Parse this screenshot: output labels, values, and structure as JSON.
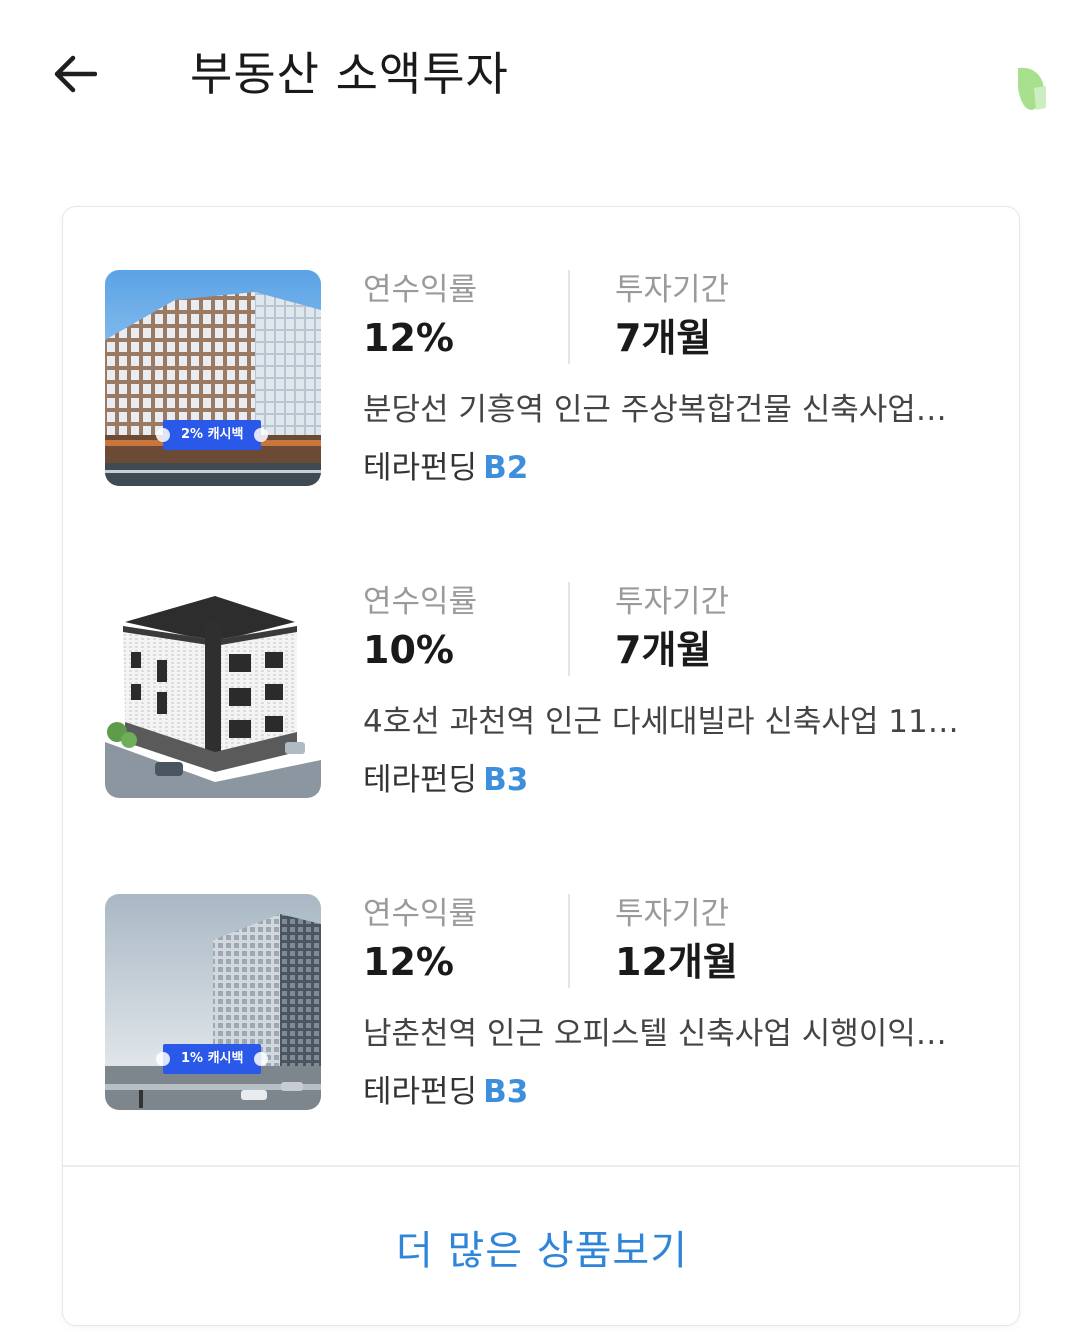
{
  "header": {
    "title": "부동산 소액투자",
    "back_icon": "arrow-left-icon",
    "leaf_icon": "leaf-icon",
    "accent_color": "#8ed67a"
  },
  "products": [
    {
      "yield_label": "연수익률",
      "yield_value": "12%",
      "period_label": "투자기간",
      "period_value": "7개월",
      "description": "분당선 기흥역 인근 주상복합건물 신축사업…",
      "platform": "테라펀딩",
      "grade": "B2",
      "badge": "2% 캐시백"
    },
    {
      "yield_label": "연수익률",
      "yield_value": "10%",
      "period_label": "투자기간",
      "period_value": "7개월",
      "description": "4호선 과천역 인근 다세대빌라 신축사업 11…",
      "platform": "테라펀딩",
      "grade": "B3"
    },
    {
      "yield_label": "연수익률",
      "yield_value": "12%",
      "period_label": "투자기간",
      "period_value": "12개월",
      "description": "남춘천역 인근 오피스텔 신축사업 시행이익…",
      "platform": "테라펀딩",
      "grade": "B3",
      "badge": "1% 캐시백"
    }
  ],
  "more_button": "더 많은 상품보기",
  "colors": {
    "grade": "#3d8fdc",
    "more": "#2f86d8",
    "badge": "#2a58e8"
  }
}
